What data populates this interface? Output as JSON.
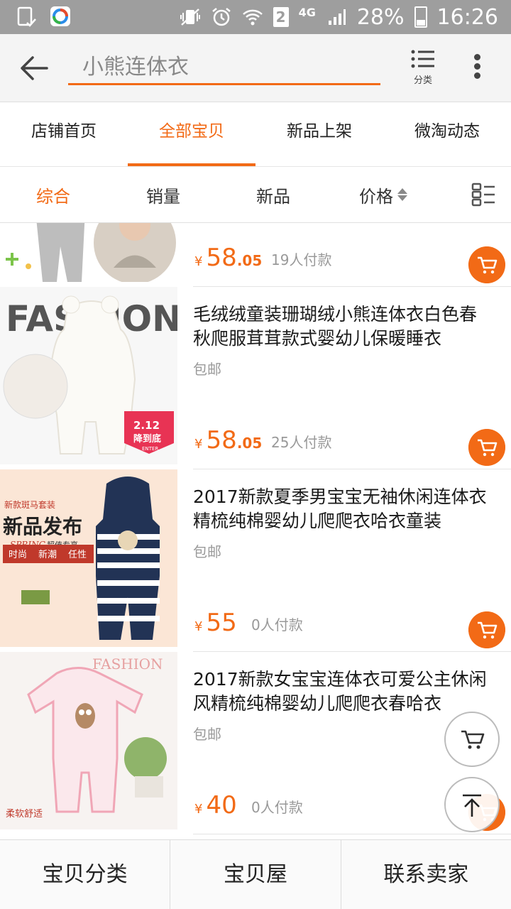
{
  "status_bar": {
    "battery": "28%",
    "time": "16:26",
    "sim_slot": "2",
    "network": "4G"
  },
  "header": {
    "search_value": "小熊连体衣",
    "category_label": "分类"
  },
  "tabs": [
    {
      "label": "店铺首页",
      "active": false
    },
    {
      "label": "全部宝贝",
      "active": true
    },
    {
      "label": "新品上架",
      "active": false
    },
    {
      "label": "微淘动态",
      "active": false
    }
  ],
  "sort": {
    "comprehensive": "综合",
    "sales": "销量",
    "new": "新品",
    "price": "价格"
  },
  "products": [
    {
      "title": "",
      "shipping": "",
      "price_int": "58",
      "price_dec": ".05",
      "sold": "19人付款"
    },
    {
      "title": "毛绒绒童装珊瑚绒小熊连体衣白色春秋爬服茸茸款式婴幼儿保暖睡衣",
      "shipping": "包邮",
      "price_int": "58",
      "price_dec": ".05",
      "sold": "25人付款",
      "image_text": {
        "banner": "FASHION",
        "badge_date": "2.12",
        "badge_text": "降到底",
        "badge_sub": "ENTER"
      }
    },
    {
      "title": "2017新款夏季男宝宝无袖休闲连体衣精梳纯棉婴幼儿爬爬衣哈衣童装",
      "shipping": "包邮",
      "price_int": "55",
      "price_dec": "",
      "sold": "0人付款",
      "image_text": {
        "top": "新款斑马套装",
        "headline": "新品发布",
        "script": "SPRING",
        "sub": "超值专享",
        "tag1": "时尚",
        "tag2": "新潮",
        "tag3": "任性"
      }
    },
    {
      "title": "2017新款女宝宝连体衣可爱公主休闲风精梳纯棉婴幼儿爬爬衣春哈衣",
      "shipping": "包邮",
      "price_int": "40",
      "price_dec": "",
      "sold": "0人付款",
      "image_text": {
        "banner": "FASHION",
        "caption": "柔软舒适"
      }
    }
  ],
  "currency_symbol": "¥",
  "bottom_bar": [
    "宝贝分类",
    "宝贝屋",
    "联系卖家"
  ],
  "colors": {
    "accent": "#f26a16",
    "status_bar": "#9e9e9e"
  },
  "icons": [
    "back-arrow-icon",
    "list-icon",
    "more-vertical-icon",
    "sort-arrows-icon",
    "grid-list-toggle-icon",
    "cart-icon",
    "back-to-top-icon"
  ]
}
